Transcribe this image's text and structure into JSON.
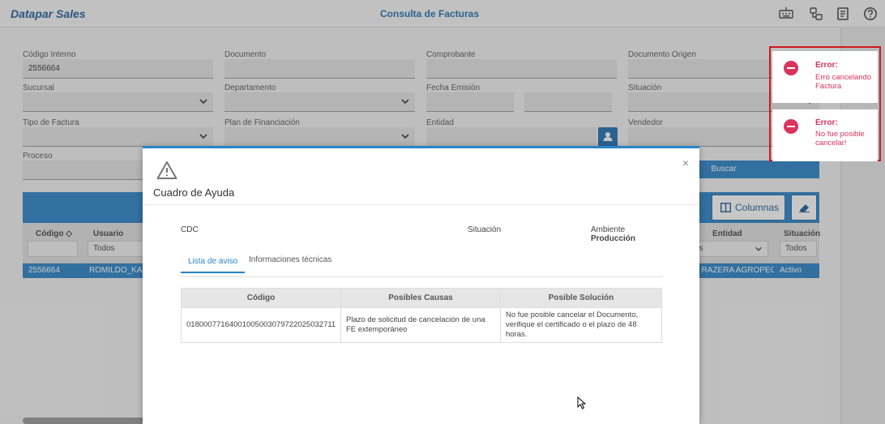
{
  "header": {
    "brand": "Datapar Sales",
    "title": "Consulta de Facturas"
  },
  "form": {
    "codigo_interno": {
      "label": "Código Interno",
      "value": "2556664"
    },
    "documento": {
      "label": "Documento"
    },
    "comprobante": {
      "label": "Comprobante"
    },
    "documento_origen": {
      "label": "Documento Origen"
    },
    "sucursal": {
      "label": "Sucursal"
    },
    "departamento": {
      "label": "Departamento"
    },
    "fecha_emision": {
      "label": "Fecha Emisión"
    },
    "situacion": {
      "label": "Situación"
    },
    "tipo_factura": {
      "label": "Tipo de Factura"
    },
    "plan_financiacion": {
      "label": "Plan de Financiación"
    },
    "entidad": {
      "label": "Entidad"
    },
    "vendedor": {
      "label": "Vendedor"
    },
    "proceso": {
      "label": "Proceso"
    },
    "buscar_label": "Buscar"
  },
  "grid": {
    "columnas_label": "Columnas",
    "headers": {
      "codigo": "Código",
      "usuario": "Usuario",
      "entidad": "Entidad",
      "situacion": "Situación"
    },
    "filters": {
      "usuario": "Todos",
      "entidad": "os",
      "situacion": "Todos"
    },
    "row": {
      "codigo": "2556664",
      "usuario": "ROMILDO_KAZ",
      "entidad": "O RAZERA AGROPECU",
      "situacion": "Activo"
    }
  },
  "modal": {
    "title": "Cuadro de Ayuda",
    "close": "×",
    "cdc_label": "CDC",
    "situacion_label": "Situación",
    "ambiente_label": "Ambiente",
    "ambiente_value": "Producción",
    "tabs": [
      "Lista de aviso",
      "Informaciones técnicas"
    ],
    "table": {
      "headers": [
        "Código",
        "Posibles Causas",
        "Posible Solución"
      ],
      "rows": [
        {
          "codigo": "01800077164001005003079722025032711",
          "causa": "Plazo de solicitud de cancelación de una FE extemporáneo",
          "solucion": "No fue posible cancelar el Documento, verifique el certificado o el plazo de 48 horas."
        }
      ]
    }
  },
  "toasts": [
    {
      "title": "Error:",
      "message": "Erro cancelando Factura"
    },
    {
      "title": "Error:",
      "message": "No fue posible cancelar!"
    }
  ],
  "colors": {
    "brand": "#1f5c99",
    "accent": "#2a83c8",
    "error": "#d9335e",
    "highlight_border": "#d0191f"
  }
}
